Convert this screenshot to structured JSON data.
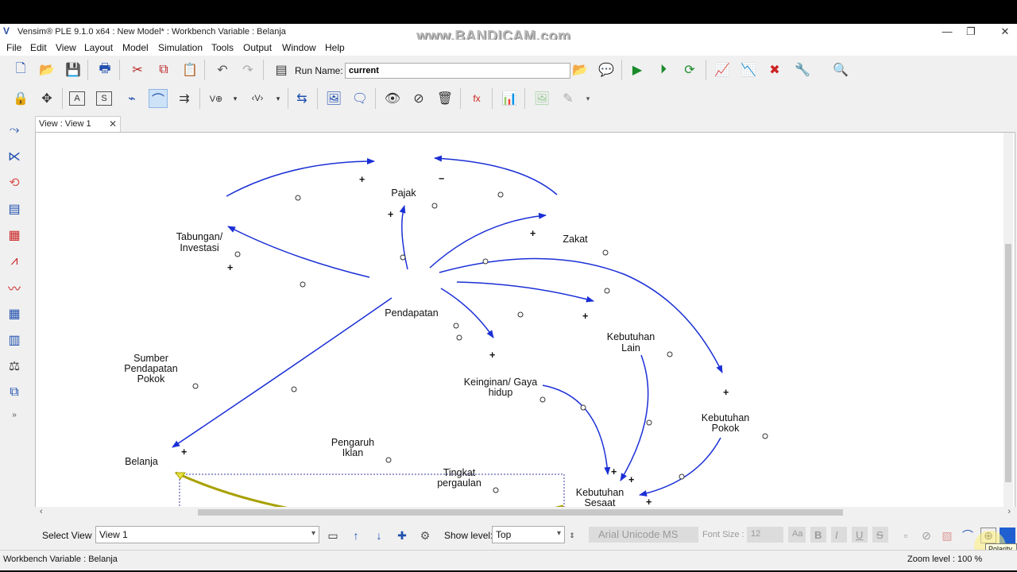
{
  "window": {
    "title": "Vensim® PLE 9.1.0 x64 : New Model* : Workbench Variable : Belanja",
    "watermark": "www.BANDICAM.com",
    "minimize": "—",
    "maximize": "❐",
    "close": "✕"
  },
  "menu": [
    "File",
    "Edit",
    "View",
    "Layout",
    "Model",
    "Simulation",
    "Tools",
    "Output",
    "Window",
    "Help"
  ],
  "toolbar": {
    "run_name_label": "Run Name:",
    "run_name_value": "current"
  },
  "tab": {
    "label": "View : View 1",
    "close": "✕"
  },
  "diagram": {
    "variables": {
      "pajak": "Pajak",
      "zakat": "Zakat",
      "tabungan_1": "Tabungan/",
      "tabungan_2": "Investasi",
      "pendapatan": "Pendapatan",
      "sumber_1": "Sumber",
      "sumber_2": "Pendapatan",
      "sumber_3": "Pokok",
      "kebutuhan_lain_1": "Kebutuhan",
      "kebutuhan_lain_2": "Lain",
      "keinginan_1": "Keinginan/ Gaya",
      "keinginan_2": "hidup",
      "kebutuhan_pokok_1": "Kebutuhan",
      "kebutuhan_pokok_2": "Pokok",
      "pengaruh_1": "Pengaruh",
      "pengaruh_2": "Iklan",
      "tingkat_1": "Tingkat",
      "tingkat_2": "pergaulan",
      "belanja": "Belanja",
      "sesaat_1": "Kebutuhan",
      "sesaat_2": "Sesaat"
    },
    "polarity": {
      "plus": "+",
      "minus": "−"
    },
    "link_color": "#1a2fd6",
    "selected_link_color": "#a8a000"
  },
  "bottom": {
    "select_view_label": "Select View :",
    "select_view_value": "View 1",
    "show_level_label": "Show level:",
    "show_level_value": "Top",
    "font_name": "Arial Unicode MS",
    "font_size_label": "Font Size :",
    "font_size_value": "12",
    "font_aa": "Aa",
    "bold": "B",
    "italic": "I",
    "underline": "U",
    "strike": "S"
  },
  "tooltip": "Polarity",
  "status": {
    "left": "Workbench Variable : Belanja",
    "zoom": "Zoom level : 100 %"
  }
}
